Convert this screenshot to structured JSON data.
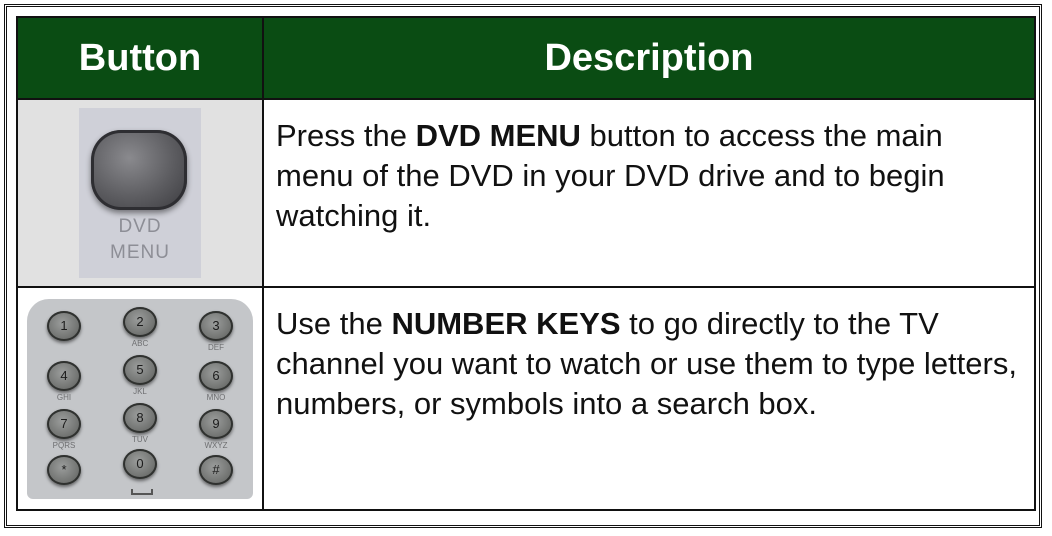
{
  "table": {
    "headers": {
      "button": "Button",
      "description": "Description"
    },
    "rows": [
      {
        "image": {
          "icon": "dvd-menu-button-icon",
          "labels": [
            "DVD",
            "MENU"
          ]
        },
        "description": {
          "before": "Press the ",
          "bold": "DVD MENU",
          "after": " button to access the main menu of the DVD in your DVD drive and to begin watching it."
        }
      },
      {
        "image": {
          "icon": "number-keypad-icon",
          "keys": [
            "1",
            "2",
            "3",
            "4",
            "5",
            "6",
            "7",
            "8",
            "9",
            "*",
            "0",
            "#"
          ],
          "key_letters": [
            "ABC",
            "DEF",
            "GHI",
            "JKL",
            "MNO",
            "PQRS",
            "TUV",
            "WXYZ"
          ]
        },
        "description": {
          "before": "Use the ",
          "bold": "NUMBER KEYS",
          "after": " to go directly to the TV channel you want to watch or use them to type letters, numbers, or symbols into a search box."
        }
      }
    ]
  },
  "colors": {
    "header_background": "#0a4c13",
    "header_text": "#ffffff",
    "image_cell_background": "#e1e1e1"
  }
}
